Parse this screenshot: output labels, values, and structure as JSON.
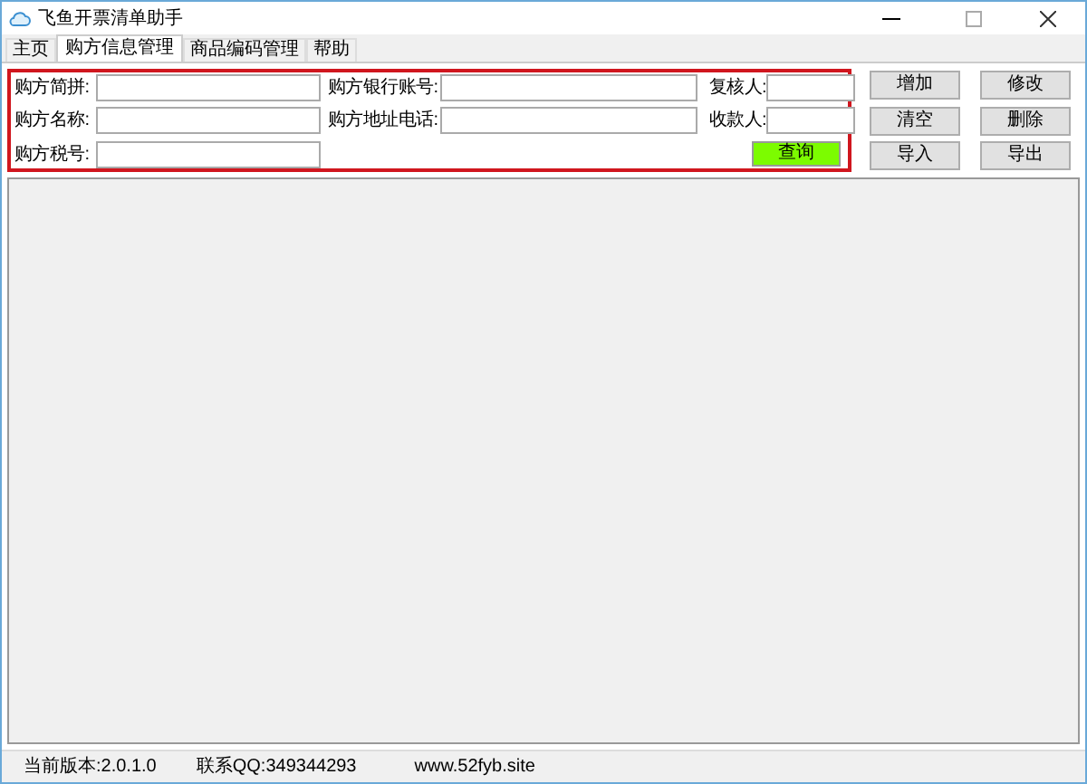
{
  "window": {
    "title": "飞鱼开票清单助手"
  },
  "tabs": [
    {
      "label": "主页",
      "selected": false
    },
    {
      "label": "购方信息管理",
      "selected": true
    },
    {
      "label": "商品编码管理",
      "selected": false
    },
    {
      "label": "帮助",
      "selected": false
    }
  ],
  "form": {
    "rows": [
      [
        {
          "label": "购方简拼:"
        },
        {
          "label": "购方银行账号:"
        },
        {
          "label": "复核人:"
        }
      ],
      [
        {
          "label": "购方名称:"
        },
        {
          "label": "购方地址电话:"
        },
        {
          "label": "收款人:"
        }
      ],
      [
        {
          "label": "购方税号:"
        }
      ]
    ],
    "query_button": "查询"
  },
  "buttons": [
    "增加",
    "修改",
    "清空",
    "删除",
    "导入",
    "导出"
  ],
  "status_bar": [
    "当前版本:2.0.1.0",
    "联系QQ:349344293",
    "www.52fyb.site"
  ]
}
